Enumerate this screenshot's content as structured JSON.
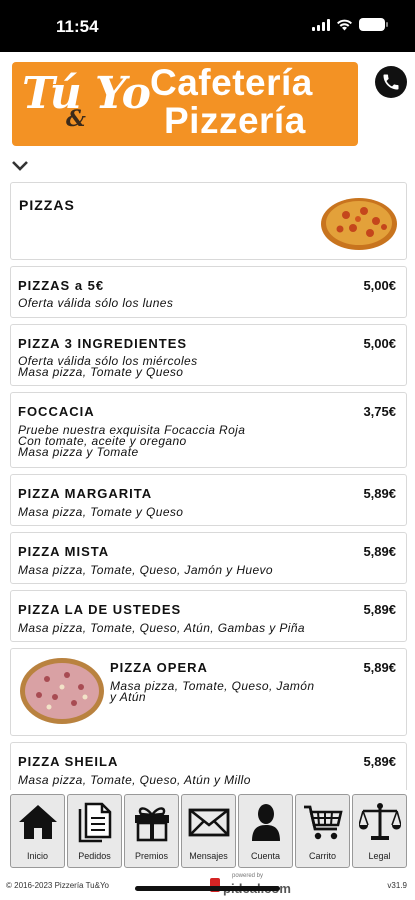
{
  "status_bar": {
    "time": "11:54"
  },
  "header": {
    "logo_script": "Tú Yo",
    "logo_amp": "&",
    "logo_line1": "Cafetería",
    "logo_line2": "Pizzería"
  },
  "category": {
    "title": "PIZZAS"
  },
  "items": [
    {
      "name": "PIZZAS a 5€",
      "price": "5,00€",
      "desc": [
        "Oferta válida sólo los lunes"
      ]
    },
    {
      "name": "PIZZA 3 INGREDIENTES",
      "price": "5,00€",
      "desc": [
        "Oferta válida sólo los miércoles",
        "Masa pizza, Tomate y Queso"
      ]
    },
    {
      "name": "FOCCACIA",
      "price": "3,75€",
      "desc": [
        "Pruebe nuestra exquisita Focaccia Roja",
        "Con tomate, aceite y oregano",
        "Masa pizza y Tomate"
      ]
    },
    {
      "name": "PIZZA MARGARITA",
      "price": "5,89€",
      "desc": [
        "Masa pizza, Tomate y Queso"
      ]
    },
    {
      "name": "PIZZA MISTA",
      "price": "5,89€",
      "desc": [
        "Masa pizza, Tomate, Queso, Jamón y Huevo"
      ]
    },
    {
      "name": "PIZZA LA DE USTEDES",
      "price": "5,89€",
      "desc": [
        "Masa pizza, Tomate, Queso, Atún, Gambas y Piña"
      ]
    },
    {
      "name": "PIZZA OPERA",
      "price": "5,89€",
      "desc": [
        "Masa pizza, Tomate, Queso, Jamón",
        "y Atún"
      ]
    },
    {
      "name": "PIZZA SHEILA",
      "price": "5,89€",
      "desc": [
        "Masa pizza, Tomate, Queso, Atún y Millo"
      ]
    }
  ],
  "tabs": [
    {
      "label": "Inicio",
      "icon": "home-icon"
    },
    {
      "label": "Pedidos",
      "icon": "document-icon"
    },
    {
      "label": "Premios",
      "icon": "gift-icon"
    },
    {
      "label": "Mensajes",
      "icon": "envelope-icon"
    },
    {
      "label": "Cuenta",
      "icon": "user-icon"
    },
    {
      "label": "Carrito",
      "icon": "cart-icon"
    },
    {
      "label": "Legal",
      "icon": "scales-icon"
    }
  ],
  "footer": {
    "copyright": "© 2016-2023 Pizzería Tu&Yo",
    "powered_small": "powered by",
    "powered_brand": "pideal.com",
    "version": "v31.9"
  }
}
